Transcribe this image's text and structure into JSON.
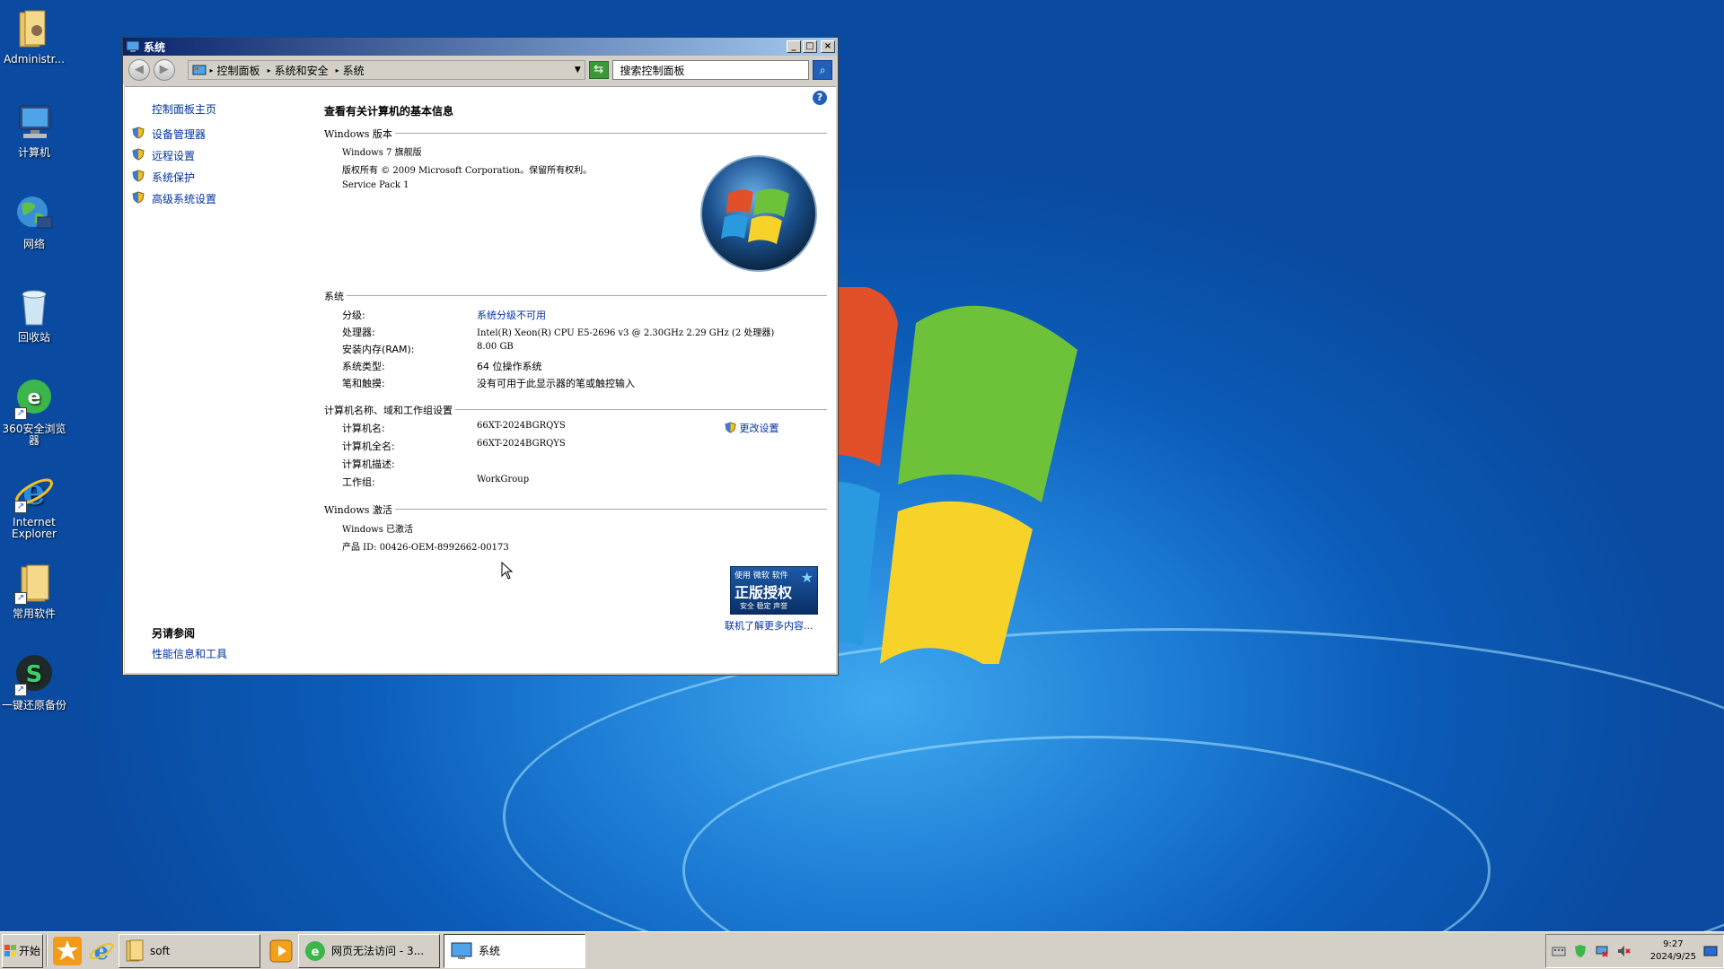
{
  "desktop": {
    "icons": [
      {
        "label": "Administr..."
      },
      {
        "label": "计算机"
      },
      {
        "label": "网络"
      },
      {
        "label": "回收站"
      },
      {
        "label": "360安全浏览器"
      },
      {
        "label": "Internet Explorer"
      },
      {
        "label": "常用软件"
      },
      {
        "label": "一键还原备份"
      }
    ]
  },
  "window": {
    "title": "系统",
    "breadcrumbs": [
      "控制面板",
      "系统和安全",
      "系统"
    ],
    "search_placeholder": "搜索控制面板",
    "left_pane": {
      "home_link": "控制面板主页",
      "links": [
        "设备管理器",
        "远程设置",
        "系统保护",
        "高级系统设置"
      ],
      "see_also_title": "另请参阅",
      "see_also_link": "性能信息和工具"
    },
    "main": {
      "page_title": "查看有关计算机的基本信息",
      "edition": {
        "section_title": "Windows 版本",
        "lines": [
          "Windows 7 旗舰版",
          "版权所有 © 2009 Microsoft Corporation。保留所有权利。",
          "Service Pack 1"
        ]
      },
      "system": {
        "section_title": "系统",
        "rows": [
          {
            "key": "分级:",
            "value": "系统分级不可用",
            "is_link": true
          },
          {
            "key": "处理器:",
            "value": "Intel(R) Xeon(R) CPU E5-2696 v3 @ 2.30GHz   2.29 GHz  (2 处理器)"
          },
          {
            "key": "安装内存(RAM):",
            "value": "8.00 GB"
          },
          {
            "key": "系统类型:",
            "value": "64 位操作系统"
          },
          {
            "key": "笔和触摸:",
            "value": "没有可用于此显示器的笔或触控输入"
          }
        ]
      },
      "computer_name": {
        "section_title": "计算机名称、域和工作组设置",
        "change_link": "更改设置",
        "rows": [
          {
            "key": "计算机名:",
            "value": "66XT-2024BGRQYS"
          },
          {
            "key": "计算机全名:",
            "value": "66XT-2024BGRQYS"
          },
          {
            "key": "计算机描述:",
            "value": ""
          },
          {
            "key": "工作组:",
            "value": "WorkGroup"
          }
        ]
      },
      "activation": {
        "section_title": "Windows 激活",
        "status": "Windows 已激活",
        "product_id": "产品 ID: 00426-OEM-8992662-00173",
        "badge_top": "使用 微软 软件",
        "badge_main": "正版授权",
        "badge_bottom": "安全 稳定 声誉",
        "more_link": "联机了解更多内容..."
      }
    }
  },
  "taskbar": {
    "start_label": "开始",
    "tasks": [
      {
        "label": "soft"
      },
      {
        "label": "网页无法访问 - 3..."
      },
      {
        "label": "系统"
      }
    ],
    "clock": {
      "time": "9:27",
      "date": "2024/9/25"
    }
  },
  "colors": {
    "link": "#0033a0",
    "title_bar_start": "#0a246a",
    "title_bar_end": "#a6caf0"
  }
}
